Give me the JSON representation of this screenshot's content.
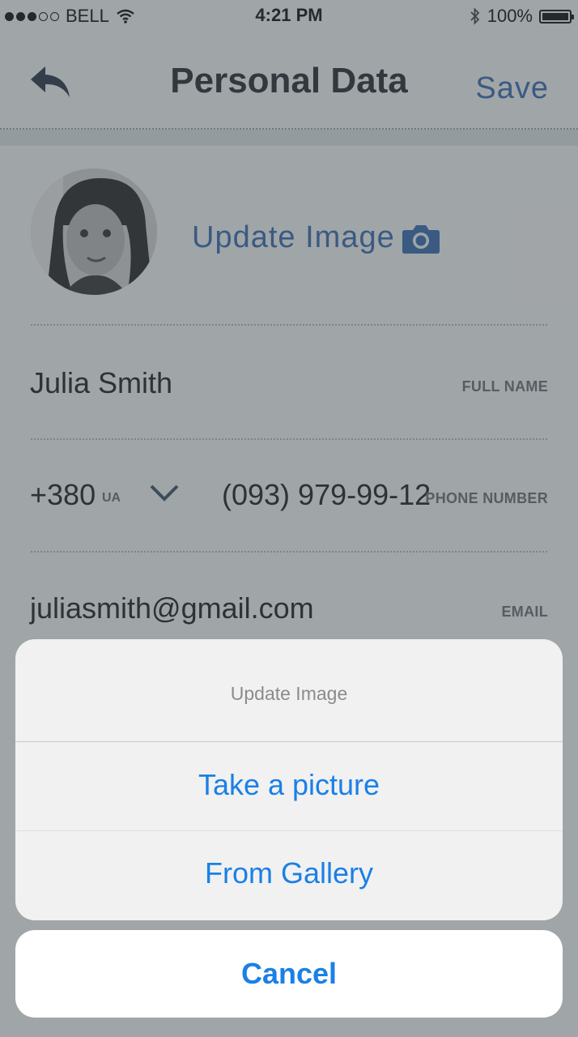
{
  "status_bar": {
    "carrier": "BELL",
    "time": "4:21 PM",
    "battery": "100%"
  },
  "nav": {
    "title": "Personal Data",
    "save_label": "Save"
  },
  "profile": {
    "update_image_label": "Update Image"
  },
  "fields": {
    "full_name": {
      "value": "Julia Smith",
      "label": "FULL NAME"
    },
    "phone": {
      "country_code": "+380",
      "country": "UA",
      "number": "(093) 979-99-12",
      "label": "PHONE NUMBER"
    },
    "email": {
      "value": "juliasmith@gmail.com",
      "label": "EMAIL"
    }
  },
  "action_sheet": {
    "title": "Update Image",
    "options": [
      "Take a picture",
      "From Gallery"
    ],
    "cancel_label": "Cancel"
  },
  "colors": {
    "accent": "#3a6fb4",
    "ios_blue": "#1a80e6"
  }
}
